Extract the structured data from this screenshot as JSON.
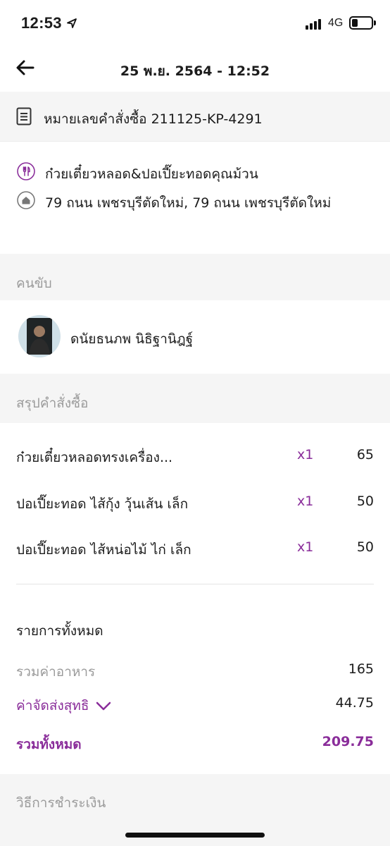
{
  "status_bar": {
    "time": "12:53",
    "network": "4G",
    "battery_level": 0.3
  },
  "header": {
    "title": "25 พ.ย. 2564 - 12:52",
    "back_icon": "arrow-left-icon"
  },
  "order": {
    "number_text": "หมายเลขคำสั่งซื้อ 211125-KP-4291",
    "icon": "document-icon"
  },
  "restaurant": {
    "name": "ก๋วยเตี๋ยวหลอด&ปอเปี๊ยะทอดคุณม้วน",
    "icon": "utensils-icon"
  },
  "address": {
    "text": "79 ถนน เพชรบุรีตัดใหม่, 79 ถนน เพชรบุรีตัดใหม่",
    "icon": "home-icon"
  },
  "driver_section": {
    "title": "คนขับ"
  },
  "driver": {
    "name": "ดนัยธนภพ นิธิฐานิฎฐ์"
  },
  "summary_section": {
    "title": "สรุปคำสั่งซื้อ"
  },
  "items": [
    {
      "name": "ก๋วยเตี๋ยวหลอดทรงเครื่อง...",
      "qty": "x1",
      "price": "65"
    },
    {
      "name": "ปอเปี๊ยะทอด ไส้กุ้ง วุ้นเส้น เล็ก",
      "qty": "x1",
      "price": "50"
    },
    {
      "name": "ปอเปี๊ยะทอด ไส้หน่อไม้ ไก่ เล็ก",
      "qty": "x1",
      "price": "50"
    }
  ],
  "totals": {
    "title": "รายการทั้งหมด",
    "food_label": "รวมค่าอาหาร",
    "food_value": "165",
    "delivery_label": "ค่าจัดส่งสุทธิ",
    "delivery_value": "44.75",
    "grand_label": "รวมทั้งหมด",
    "grand_value": "209.75"
  },
  "payment_section": {
    "title": "วิธีการชำระเงิน"
  },
  "colors": {
    "accent": "#8a2d9a",
    "muted": "#9b9b9b",
    "band": "#f5f5f5"
  }
}
